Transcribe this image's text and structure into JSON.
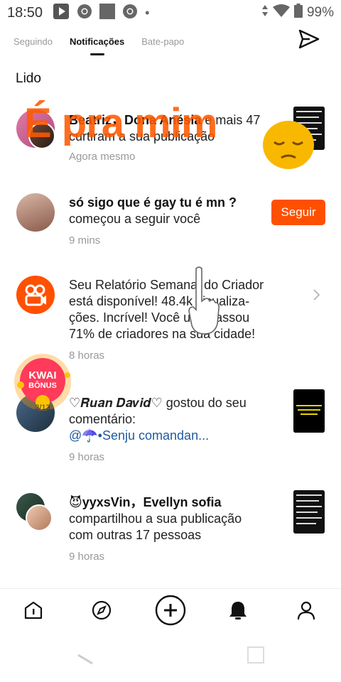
{
  "status_bar": {
    "time": "18:50",
    "battery": "99%"
  },
  "tabs": [
    {
      "label": "Seguindo"
    },
    {
      "label": "Notificações"
    },
    {
      "label": "Bate-papo"
    }
  ],
  "section_title": "Lido",
  "notifications": [
    {
      "names": "Beatriz，Dona Anésia",
      "text_suffix": " e mais 47",
      "text_line2": "curtiram a sua publicação",
      "time": "Agora mesmo"
    },
    {
      "names": "só sigo que é gay tu é mn ?",
      "text_line2": "começou a seguir você",
      "time": "9 mins",
      "button": "Seguir"
    },
    {
      "lines": [
        "Seu Relatório Semanal do Criador",
        "está disponível! 48.4k visualiza-",
        "ções. Incrível! Você ultrapassou",
        "71% de criadores na sua cidade!"
      ],
      "time": "8 horas"
    },
    {
      "line1": "♡𝑹𝒖𝒂𝒏 𝑫𝒂𝒗𝒊𝒅♡ gostou do seu",
      "line2": "comentário:",
      "mention": "@☂️•Senju  comandan...",
      "time": "9 horas",
      "progress": "3/13"
    },
    {
      "names": "😈yyxsVin，Evellyn sofia",
      "line2": "compartilhou a sua publicação",
      "line3": "com outras 17 pessoas",
      "time": "9 horas"
    }
  ],
  "overlay": {
    "caption": "É pra mim",
    "badge_line1": "KWAI",
    "badge_line2": "BÔNUS"
  },
  "colors": {
    "accent": "#ff5000",
    "link": "#1f5a9e"
  },
  "icons": [
    "send-icon",
    "home-icon",
    "discover-icon",
    "create-icon",
    "bell-icon",
    "profile-icon"
  ]
}
